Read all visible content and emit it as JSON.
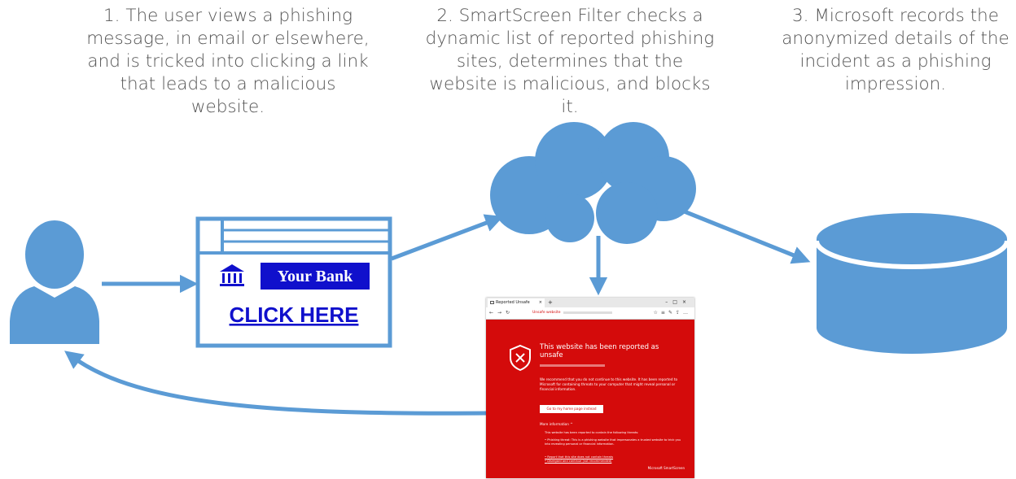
{
  "steps": [
    {
      "text": "1. The user views a phishing message, in email or elsewhere, and is tricked into clicking a link that leads to a malicious website."
    },
    {
      "text": "2. SmartScreen Filter checks a dynamic list of reported phishing sites, determines that the website is malicious, and blocks it."
    },
    {
      "text": "3. Microsoft records the anonymized details of the incident as a phishing impression."
    }
  ],
  "email": {
    "bank_name": "Your Bank",
    "link_text": "CLICK HERE"
  },
  "browser": {
    "tab_title": "Reported Unsafe Websit",
    "url_warning": "Unsafe website",
    "heading": "This website has been reported as unsafe",
    "body": "We recommend that you do not continue to this website. It has been reported to Microsoft for containing threats to your computer that might reveal personal or financial information.",
    "button": "Go to my home page instead",
    "more_info": "More information ^",
    "detail_intro": "This website has been reported to contain the following threats:",
    "detail_item": "Phishing threat: This is a phishing website that impersonates a trusted website to trick you into revealing personal or financial information.",
    "link1": "Report that this site does not contain threats",
    "link2": "Disregard and continue (not recommended)",
    "footer": "Microsoft SmartScreen"
  },
  "colors": {
    "accent": "#5b9bd5",
    "bank_blue": "#1010cc",
    "link_blue": "#1010cc",
    "warning_red": "#d40b0b"
  },
  "icons": [
    "user-icon",
    "bank-icon",
    "cloud-icon",
    "database-icon",
    "shield-warning-icon"
  ]
}
